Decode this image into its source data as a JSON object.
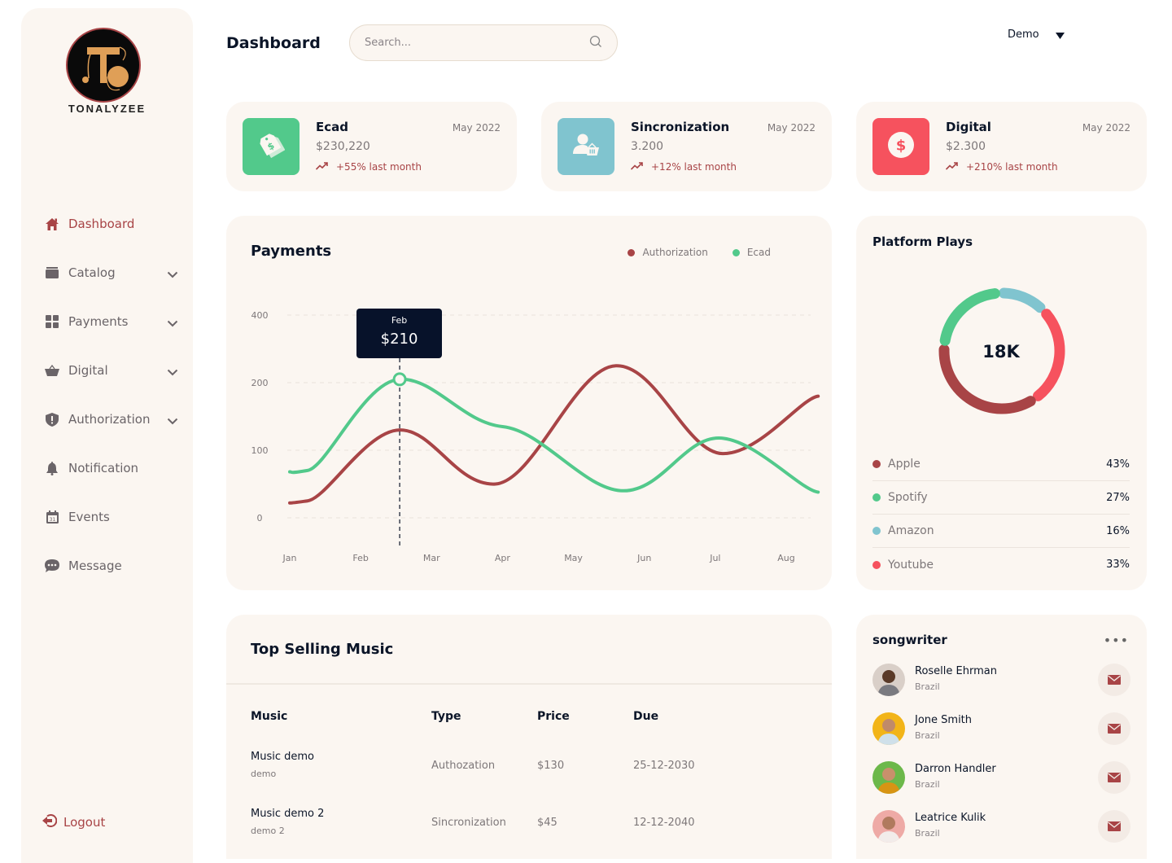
{
  "brand": {
    "name": "TONALYZEE"
  },
  "sidebar": {
    "items": [
      {
        "label": "Dashboard",
        "icon": "home-icon",
        "active": true,
        "expandable": false
      },
      {
        "label": "Catalog",
        "icon": "archive-icon",
        "active": false,
        "expandable": true
      },
      {
        "label": "Payments",
        "icon": "grid-icon",
        "active": false,
        "expandable": true
      },
      {
        "label": "Digital",
        "icon": "basket-icon",
        "active": false,
        "expandable": true
      },
      {
        "label": "Authorization",
        "icon": "shield-icon",
        "active": false,
        "expandable": true
      },
      {
        "label": "Notification",
        "icon": "bell-icon",
        "active": false,
        "expandable": false
      },
      {
        "label": "Events",
        "icon": "calendar-icon",
        "active": false,
        "expandable": false
      },
      {
        "label": "Message",
        "icon": "chat-icon",
        "active": false,
        "expandable": false
      }
    ],
    "logout": "Logout"
  },
  "header": {
    "title": "Dashboard",
    "search_placeholder": "Search...",
    "user": "Demo"
  },
  "stats": [
    {
      "title": "Ecad",
      "date": "May 2022",
      "value": "$230,220",
      "trend": "+55% last month",
      "color": "#52c98b",
      "icon": "price-tag-icon"
    },
    {
      "title": "Sincronization",
      "date": "May 2022",
      "value": "3.200",
      "trend": "+12% last month",
      "color": "#80c4cf",
      "icon": "user-basket-icon"
    },
    {
      "title": "Digital",
      "date": "May 2022",
      "value": "$2.300",
      "trend": "+210% last month",
      "color": "#f6525e",
      "icon": "dollar-icon"
    }
  ],
  "payments": {
    "title": "Payments",
    "tooltip": {
      "month": "Feb",
      "value": "$210"
    }
  },
  "chart_data": {
    "type": "line",
    "title": "Payments",
    "categories": [
      "Jan",
      "Feb",
      "Mar",
      "Apr",
      "May",
      "Jun",
      "Jul",
      "Aug"
    ],
    "y_ticks": [
      "0",
      "100",
      "200",
      "400"
    ],
    "ylim": [
      0,
      400
    ],
    "grid": true,
    "legend_position": "top-right",
    "series": [
      {
        "name": "Authorization",
        "color": "#a84446",
        "x": [
          0,
          0.25,
          1.55,
          2.9,
          4.6,
          6.1,
          7.45
        ],
        "values": [
          22,
          25,
          130,
          50,
          250,
          95,
          180
        ]
      },
      {
        "name": "Ecad",
        "color": "#52c98b",
        "x": [
          0,
          0.25,
          1.55,
          3.0,
          4.7,
          6.05,
          7.45
        ],
        "values": [
          68,
          70,
          210,
          135,
          40,
          118,
          38
        ]
      }
    ],
    "highlight": {
      "series": "Ecad",
      "category": "Feb",
      "value": 210
    }
  },
  "platform": {
    "title": "Platform Plays",
    "total": "18K",
    "items": [
      {
        "name": "Apple",
        "pct": "43%",
        "value": 43,
        "color": "#a84446"
      },
      {
        "name": "Spotify",
        "pct": "27%",
        "value": 27,
        "color": "#52c98b"
      },
      {
        "name": "Amazon",
        "pct": "16%",
        "value": 16,
        "color": "#80c4cf"
      },
      {
        "name": "Youtube",
        "pct": "33%",
        "value": 33,
        "color": "#f6525e"
      }
    ]
  },
  "top_selling": {
    "title": "Top Selling Music",
    "columns": [
      "Music",
      "Type",
      "Price",
      "Due"
    ],
    "rows": [
      {
        "music": "Music demo",
        "sub": "demo",
        "type": "Authozation",
        "price": "$130",
        "due": "25-12-2030"
      },
      {
        "music": "Music demo 2",
        "sub": "demo 2",
        "type": "Sincronization",
        "price": "$45",
        "due": "12-12-2040"
      }
    ]
  },
  "songwriter": {
    "title": "songwriter",
    "more": "•••",
    "people": [
      {
        "name": "Roselle Ehrman",
        "location": "Brazil",
        "avatar_bg": "#d9cfc8"
      },
      {
        "name": "Jone Smith",
        "location": "Brazil",
        "avatar_bg": "#f2b418"
      },
      {
        "name": "Darron Handler",
        "location": "Brazil",
        "avatar_bg": "#6cb84a"
      },
      {
        "name": "Leatrice Kulik",
        "location": "Brazil",
        "avatar_bg": "#eeaaa6"
      }
    ]
  }
}
